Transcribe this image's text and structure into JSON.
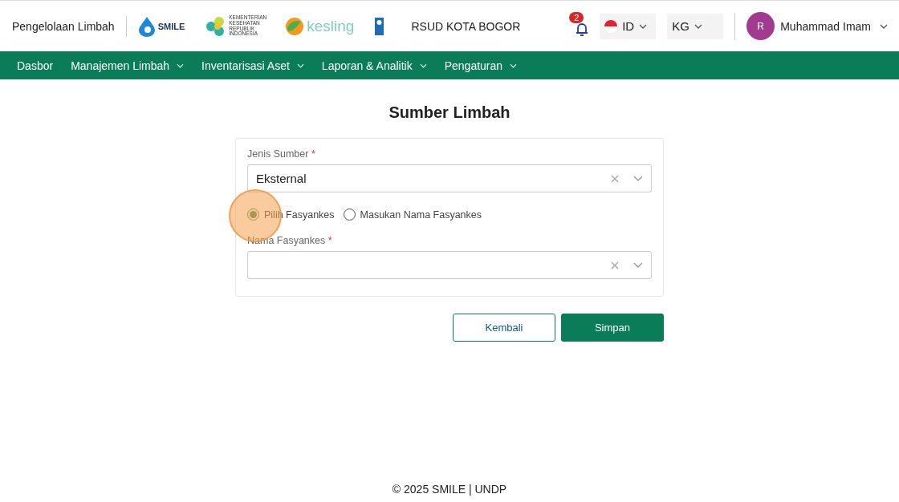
{
  "header": {
    "app_name": "Pengelolaan Limbah",
    "logos": [
      {
        "kind": "smile",
        "text": "SMILE"
      },
      {
        "kind": "kemenkes",
        "text": "KEMENTERIAN KESEHATAN REPUBLIK INDONESIA"
      },
      {
        "kind": "kesling",
        "text": "kesling"
      },
      {
        "kind": "undp"
      }
    ],
    "facility": "RSUD KOTA BOGOR",
    "notifications": "2",
    "language": "ID",
    "unit": "KG",
    "user": {
      "initial": "R",
      "name": "Muhammad Imam"
    }
  },
  "nav": [
    {
      "label": "Dasbor",
      "dropdown": false
    },
    {
      "label": "Manajemen Limbah",
      "dropdown": true
    },
    {
      "label": "Inventarisasi Aset",
      "dropdown": true
    },
    {
      "label": "Laporan & Analitik",
      "dropdown": true
    },
    {
      "label": "Pengaturan",
      "dropdown": true
    }
  ],
  "page_title": "Sumber Limbah",
  "form": {
    "source_type": {
      "label": "Jenis Sumber",
      "required_mark": "*",
      "value": "Eksternal"
    },
    "options": [
      {
        "label": "Pilih Fasyankes",
        "selected": true
      },
      {
        "label": "Masukan Nama Fasyankes",
        "selected": false
      }
    ],
    "facility_name": {
      "label": "Nama Fasyankes",
      "required_mark": "*"
    }
  },
  "buttons": [
    {
      "label": "Kembali",
      "kind": "outline"
    },
    {
      "label": "Simpan",
      "kind": "primary"
    }
  ],
  "footer": "© 2025 SMILE | UNDP"
}
